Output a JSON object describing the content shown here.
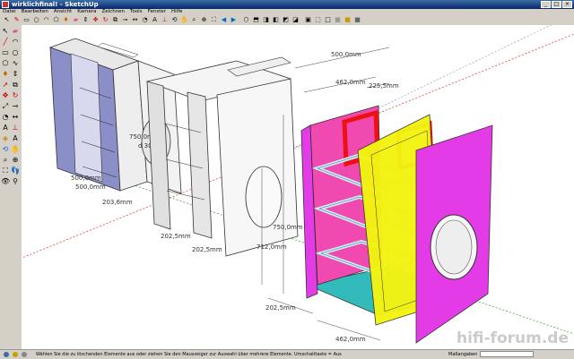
{
  "window": {
    "title": "wirklichfinal! - SketchUp"
  },
  "menu": [
    "Datei",
    "Bearbeiten",
    "Ansicht",
    "Kamera",
    "Zeichnen",
    "Tools",
    "Fenster",
    "Hilfe"
  ],
  "toolbar_icons": [
    "select-icon",
    "pencil-icon",
    "rectangle-icon",
    "circle-icon",
    "arc-icon",
    "polygon-icon",
    "paint-icon",
    "eraser-icon",
    "pushpull-icon",
    "move-icon",
    "rotate-icon",
    "offset-icon",
    "tape-icon",
    "dimension-icon",
    "protractor-icon",
    "text-icon",
    "axes-icon",
    "orbit-icon",
    "pan-icon",
    "zoom-icon",
    "zoom-window-icon",
    "zoom-extents-icon",
    "previous-view-icon",
    "next-view-icon",
    "iso-view-icon",
    "top-view-icon",
    "front-view-icon",
    "right-view-icon",
    "back-view-icon",
    "left-view-icon",
    "xray-icon",
    "wireframe-icon",
    "hidden-line-icon",
    "shaded-icon",
    "textured-icon",
    "monochrome-icon"
  ],
  "left_tools": [
    "select-icon",
    "eraser-icon",
    "line-icon",
    "arc-icon",
    "rectangle-icon",
    "circle-icon",
    "polygon-icon",
    "freehand-icon",
    "paint-icon",
    "pushpull-icon",
    "followme-icon",
    "offset-icon",
    "move-icon",
    "rotate-icon",
    "scale-icon",
    "tape-icon",
    "protractor-icon",
    "dimension-icon",
    "text-icon",
    "axes-icon",
    "section-icon",
    "3dtext-icon",
    "orbit-icon",
    "pan-icon",
    "zoom-icon",
    "zoom-window-icon",
    "zoom-extents-icon",
    "walk-icon",
    "lookaround-icon",
    "position-camera-icon"
  ],
  "dimensions": {
    "box1_height": "750,0mm",
    "box1_depth": "500,0mm",
    "box1_depth2": "500,0mm",
    "box1_width": "203,6mm",
    "box1_diameter": "d 300",
    "box2_width1": "202,5mm",
    "box2_width2": "202,5mm",
    "box3_width": "500,0mm",
    "box3_inner": "462,0mm",
    "box3_offset": "225,5mm",
    "box3_height": "750,0mm",
    "box3_height2": "712,0mm",
    "box3_bottom": "462,0mm",
    "box3_small": "202,5mm"
  },
  "status": {
    "message": "Wählen Sie die zu löschenden Elemente aus oder ziehen Sie den Mauszeiger zur Auswahl über mehrere Elemente. Umschalttaste = Aus",
    "measure_label": "Maßangaben",
    "measure_value": ""
  },
  "watermark": "hifi-forum.de",
  "colors": {
    "magenta": "#e33ce6",
    "pink": "#f04ab0",
    "red": "#ee1111",
    "yellow": "#f3f311",
    "cyan": "#33bbbb",
    "lightblue": "#c6f0f8"
  }
}
